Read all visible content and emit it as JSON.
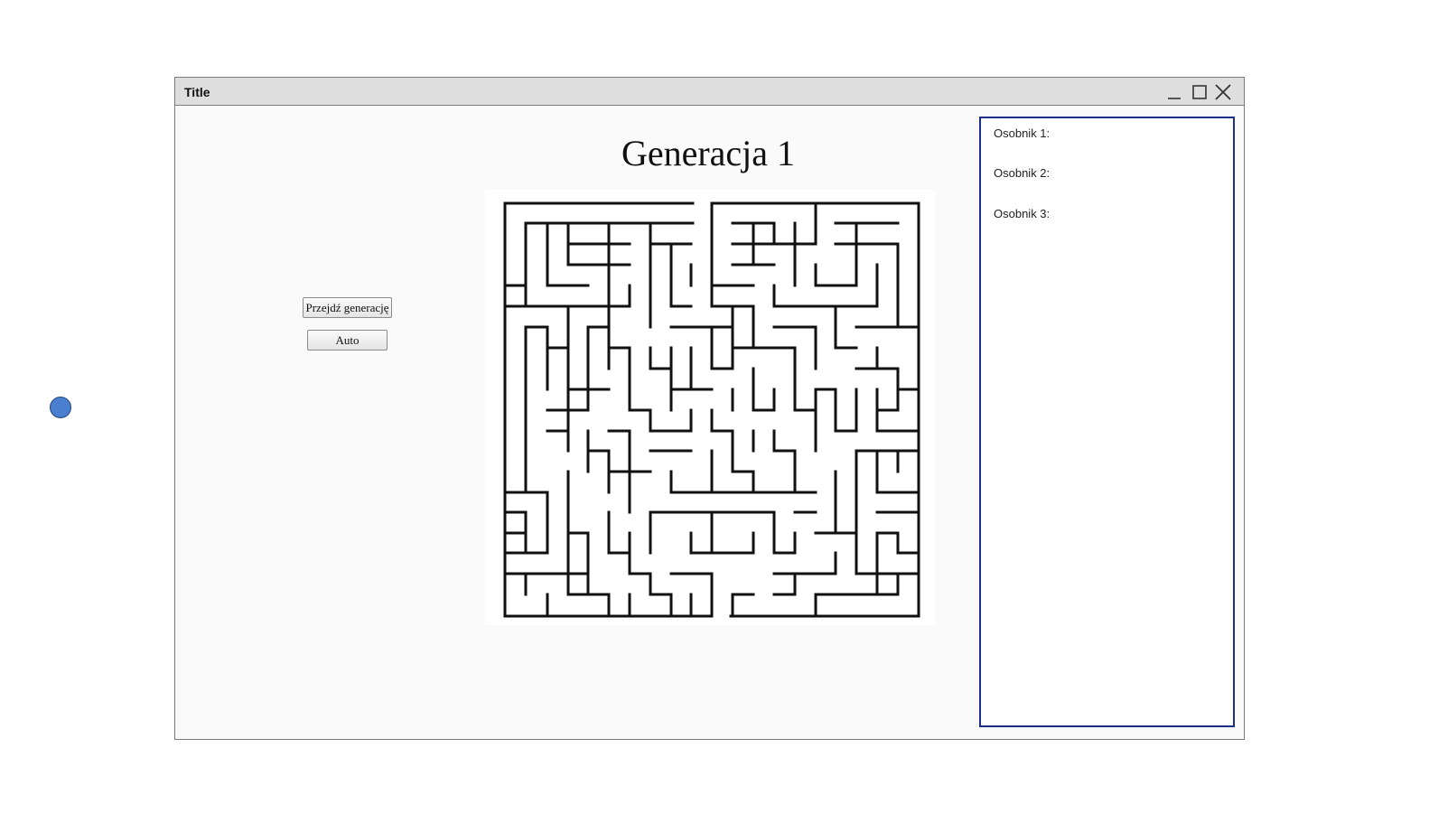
{
  "window": {
    "title": "Title",
    "controls": {
      "minimize": "minimize-icon",
      "maximize": "maximize-icon",
      "close": "close-icon"
    }
  },
  "main": {
    "heading": "Generacja 1",
    "buttons": {
      "next_generation": "Przejdź generację",
      "auto": "Auto"
    }
  },
  "side_panel": {
    "individuals": [
      "Osobnik 1:",
      "Osobnik 2:",
      "Osobnik 3:"
    ]
  },
  "colors": {
    "accent_dot": "#4a7fcf",
    "panel_border": "#1c2f87",
    "maze_wall": "#111111"
  },
  "icons": {
    "side_dot": "circle-icon"
  }
}
